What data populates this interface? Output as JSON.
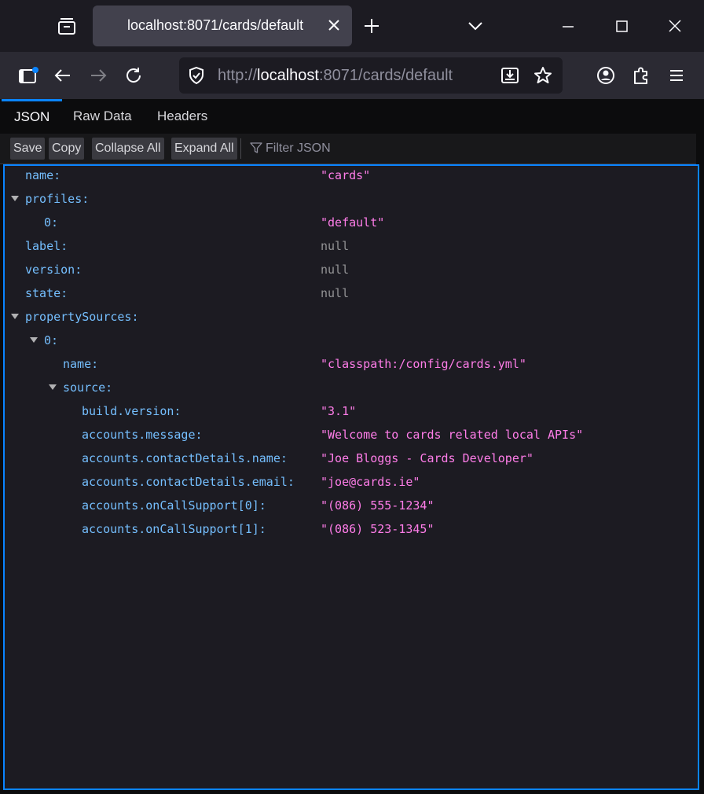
{
  "browser": {
    "tab_title": "localhost:8071/cards/default",
    "url_prefix": "http://",
    "url_host": "localhost",
    "url_rest": ":8071/cards/default"
  },
  "viewer": {
    "tabs": [
      "JSON",
      "Raw Data",
      "Headers"
    ],
    "toolbar": {
      "save": "Save",
      "copy": "Copy",
      "collapse": "Collapse All",
      "expand": "Expand All",
      "filter_placeholder": "Filter JSON"
    }
  },
  "json_rows": [
    {
      "key": "name:",
      "value": "\"cards\"",
      "kind": "str",
      "indent": 0
    },
    {
      "key": "profiles:",
      "value": "",
      "kind": "none",
      "indent": 0,
      "expanded": true
    },
    {
      "key": "0:",
      "value": "\"default\"",
      "kind": "str",
      "indent": 1
    },
    {
      "key": "label:",
      "value": "null",
      "kind": "null",
      "indent": 0
    },
    {
      "key": "version:",
      "value": "null",
      "kind": "null",
      "indent": 0
    },
    {
      "key": "state:",
      "value": "null",
      "kind": "null",
      "indent": 0
    },
    {
      "key": "propertySources:",
      "value": "",
      "kind": "none",
      "indent": 0,
      "expanded": true
    },
    {
      "key": "0:",
      "value": "",
      "kind": "none",
      "indent": 1,
      "expanded": true
    },
    {
      "key": "name:",
      "value": "\"classpath:/config/cards.yml\"",
      "kind": "str",
      "indent": 2
    },
    {
      "key": "source:",
      "value": "",
      "kind": "none",
      "indent": 2,
      "expanded": true
    },
    {
      "key": "build.version:",
      "value": "\"3.1\"",
      "kind": "str",
      "indent": 3
    },
    {
      "key": "accounts.message:",
      "value": "\"Welcome to cards related local APIs\"",
      "kind": "str",
      "indent": 3
    },
    {
      "key": "accounts.contactDetails.name:",
      "value": "\"Joe Bloggs - Cards Developer\"",
      "kind": "str",
      "indent": 3
    },
    {
      "key": "accounts.contactDetails.email:",
      "value": "\"joe@cards.ie\"",
      "kind": "str",
      "indent": 3
    },
    {
      "key": "accounts.onCallSupport[0]:",
      "value": "\"(086) 555-1234\"",
      "kind": "str",
      "indent": 3
    },
    {
      "key": "accounts.onCallSupport[1]:",
      "value": "\"(086) 523-1345\"",
      "kind": "str",
      "indent": 3
    }
  ],
  "colors": {
    "accent": "#0a84ff",
    "key": "#75bfff",
    "string": "#ff7de9",
    "null": "#939395"
  }
}
